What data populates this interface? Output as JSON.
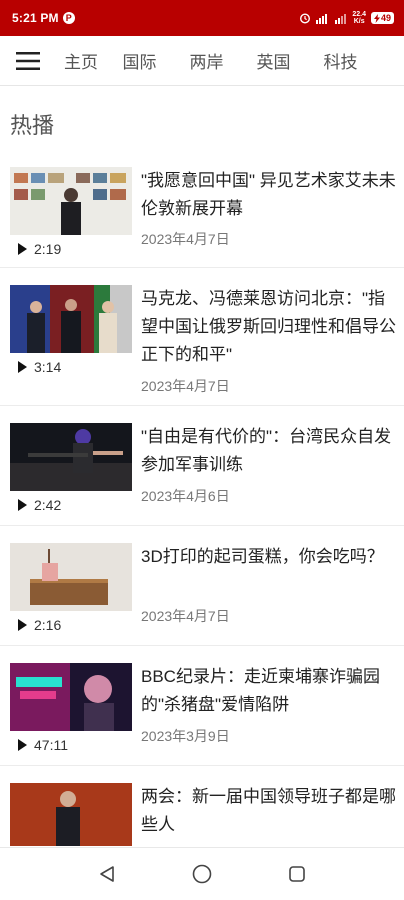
{
  "status_bar": {
    "time": "5:21 PM",
    "app_badge": "P",
    "speed_value": "22.4",
    "speed_unit": "K/s",
    "battery": "49"
  },
  "nav": {
    "tabs": [
      {
        "label": "主页"
      },
      {
        "label": "国际"
      },
      {
        "label": "两岸"
      },
      {
        "label": "英国"
      },
      {
        "label": "科技"
      }
    ]
  },
  "section_title": "热播",
  "items": [
    {
      "title": "\"我愿意回中国\" 异见艺术家艾未未伦敦新展开幕",
      "date": "2023年4月7日",
      "duration": "2:19"
    },
    {
      "title": "马克龙、冯德莱恩访问北京：\"指望中国让俄罗斯回归理性和倡导公正下的和平\"",
      "date": "2023年4月7日",
      "duration": "3:14"
    },
    {
      "title": "\"自由是有代价的\"：台湾民众自发参加军事训练",
      "date": "2023年4月6日",
      "duration": "2:42"
    },
    {
      "title": "3D打印的起司蛋糕，你会吃吗？",
      "date": "2023年4月7日",
      "duration": "2:16"
    },
    {
      "title": "BBC纪录片：走近柬埔寨诈骗园的\"杀猪盘\"爱情陷阱",
      "date": "2023年3月9日",
      "duration": "47:11"
    },
    {
      "title": "两会：新一届中国领导班子都是哪些人",
      "date": "",
      "duration": ""
    }
  ],
  "colors": {
    "brand": "#b80000",
    "text": "#222222",
    "muted": "#777777"
  }
}
